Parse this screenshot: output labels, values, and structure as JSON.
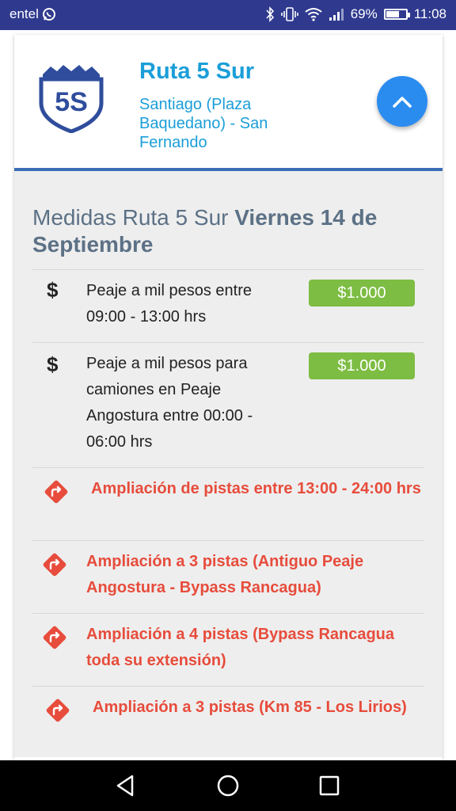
{
  "status_bar": {
    "carrier": "entel",
    "battery_percent": "69%",
    "battery_level": 0.69,
    "time": "11:08"
  },
  "header": {
    "logo_text": "5S",
    "title": "Ruta 5 Sur",
    "subtitle": "Santiago (Plaza Baquedano) - San Fernando"
  },
  "section": {
    "title_normal": "Medidas Ruta 5 Sur ",
    "title_bold": "Viernes 14 de Septiembre"
  },
  "toll_items": [
    {
      "icon": "dollar-icon",
      "symbol": "$",
      "text": "Peaje a mil pesos entre 09:00 - 13:00 hrs",
      "badge": "$1.000"
    },
    {
      "icon": "dollar-icon",
      "symbol": "$",
      "text": "Peaje a mil pesos para camiones en Peaje Angostura entre 00:00 - 06:00 hrs",
      "badge": "$1.000"
    }
  ],
  "lane_items": [
    {
      "icon": "turn-right-icon",
      "text": "Ampliación de pistas entre 13:00 - 24:00 hrs"
    },
    {
      "icon": "turn-right-icon",
      "text": "Ampliación a 3 pistas (Antiguo Peaje Angostura - Bypass Rancagua)"
    },
    {
      "icon": "turn-right-icon",
      "text": "Ampliación a 4 pistas (Bypass Rancagua toda su extensión)"
    },
    {
      "icon": "turn-right-icon",
      "text": "Ampliación a 3 pistas (Km 85 - Los Lirios)"
    }
  ],
  "colors": {
    "status_bar": "#2f3a8f",
    "brand_blue": "#1a9ed8",
    "header_border": "#3a6db5",
    "fab": "#2b8cf0",
    "badge_green": "#7dbd43",
    "alert_red": "#e74c3c",
    "section_text": "#5c7186"
  }
}
